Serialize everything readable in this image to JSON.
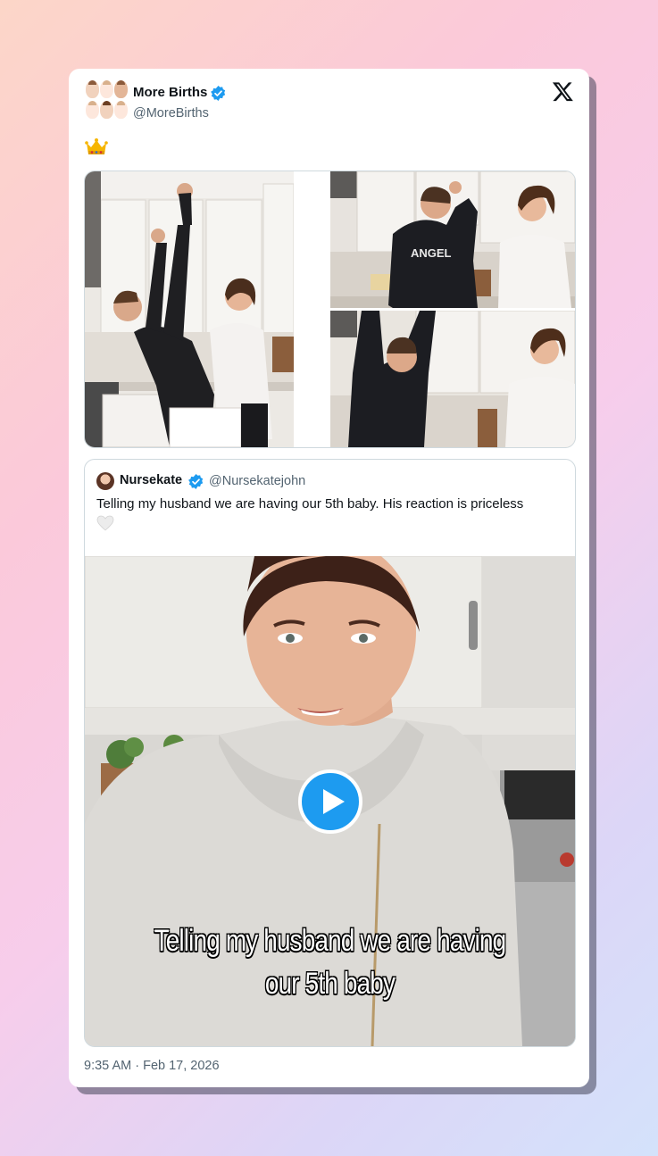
{
  "tweet": {
    "author_name": "More Births",
    "author_handle": "@MoreBirths",
    "text_emoji": "crown",
    "timestamp": "9:35 AM · Feb 17, 2026",
    "icons": {
      "avatar": "babies-emoji-avatar",
      "verified": "verified-badge-icon",
      "platform": "x-logo-icon"
    },
    "accent_color": "#1d9bf0"
  },
  "quoted_tweet": {
    "author_name": "Nursekate",
    "author_handle": "@Nursekatejohn",
    "text": "Telling my husband we are having our 5th baby. His reaction is priceless",
    "text_emoji": "white-heart",
    "video_caption_line1": "Telling my husband we are having",
    "video_caption_line2": "our 5th baby"
  }
}
